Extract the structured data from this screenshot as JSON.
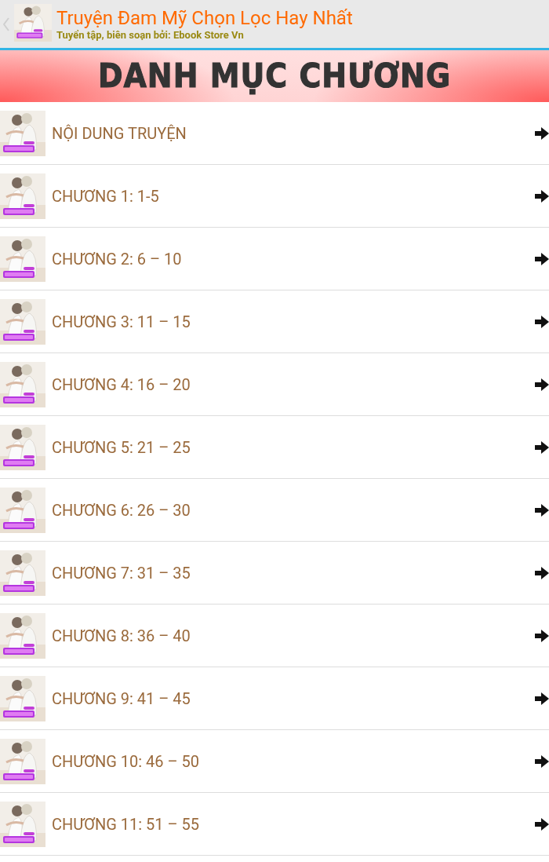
{
  "header": {
    "title": "Truyện Đam Mỹ Chọn Lọc Hay Nhất",
    "subtitle": "Tuyển tập, biên soạn bởi: Ebook Store Vn"
  },
  "banner": {
    "title": "DANH MỤC CHƯƠNG"
  },
  "chapters": [
    {
      "title": "NỘI DUNG TRUYỆN"
    },
    {
      "title": "CHƯƠNG 1: 1-5"
    },
    {
      "title": "CHƯƠNG 2: 6 – 10"
    },
    {
      "title": "CHƯƠNG 3: 11 – 15"
    },
    {
      "title": "CHƯƠNG 4: 16 – 20"
    },
    {
      "title": "CHƯƠNG 5: 21 – 25"
    },
    {
      "title": "CHƯƠNG 6: 26 – 30"
    },
    {
      "title": "CHƯƠNG 7: 31 – 35"
    },
    {
      "title": "CHƯƠNG 8: 36 – 40"
    },
    {
      "title": "CHƯƠNG 9: 41 – 45"
    },
    {
      "title": "CHƯƠNG 10: 46 – 50"
    },
    {
      "title": "CHƯƠNG 11: 51 – 55"
    }
  ]
}
